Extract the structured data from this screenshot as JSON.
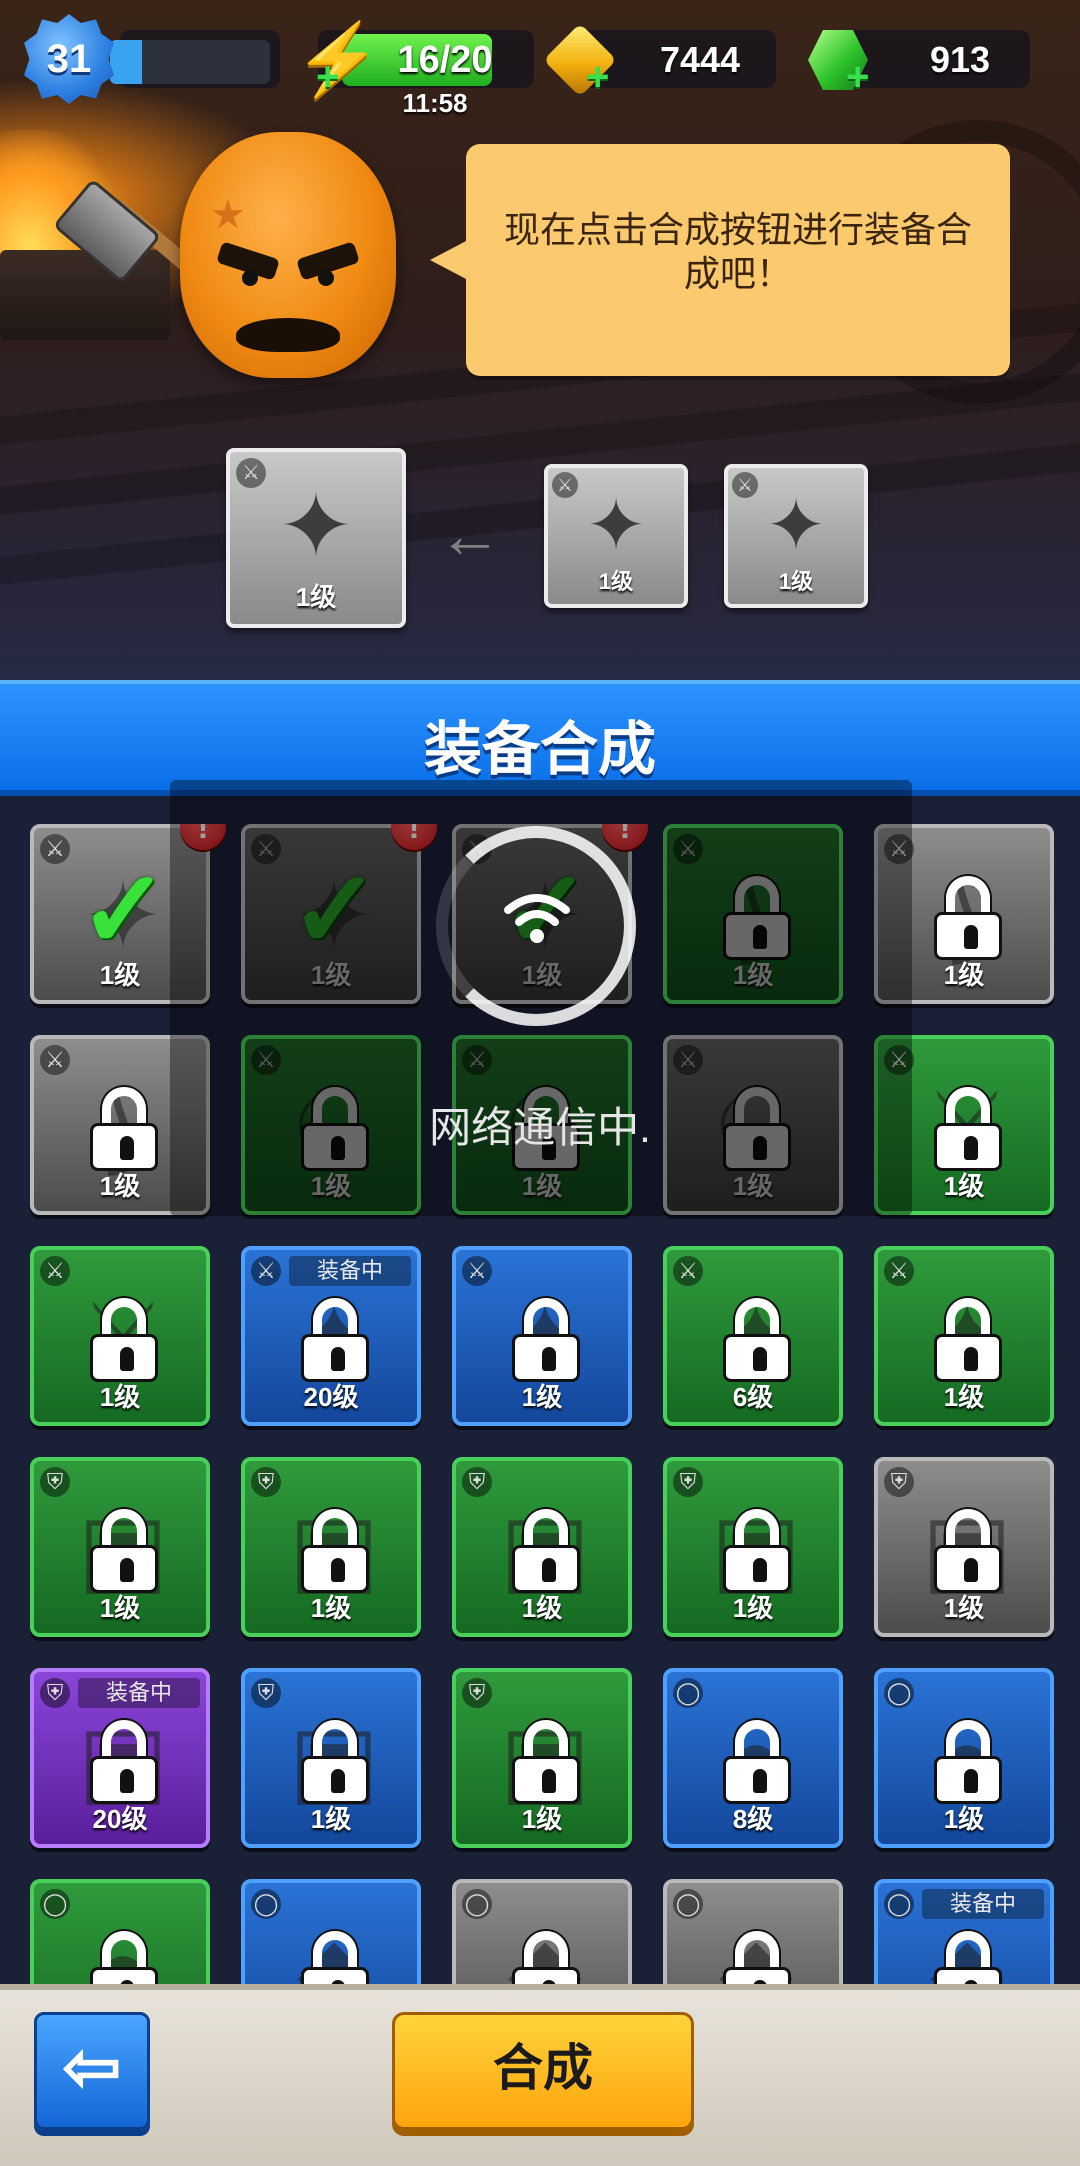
{
  "hud": {
    "player_level": "31",
    "xp_progress": 0.2,
    "energy": "16/20",
    "energy_timer": "11:58",
    "gold": "7444",
    "gems": "913"
  },
  "speech": "现在点击合成按钮进行装备合成吧！",
  "preview": {
    "result_level": "1级",
    "material_1_level": "1级",
    "material_2_level": "1级"
  },
  "header_title": "装备合成",
  "network_status": "网络通信中.",
  "equipped_label": "装备中",
  "grid_rows": [
    [
      {
        "color": "grey",
        "type": "weapon",
        "item": "shuriken",
        "level": "1级",
        "selected": true,
        "alert": true
      },
      {
        "color": "grey",
        "type": "weapon",
        "item": "shuriken",
        "level": "1级",
        "selected": true,
        "alert": true,
        "dim": true
      },
      {
        "color": "grey",
        "type": "weapon",
        "item": "shuriken",
        "level": "1级",
        "selected": true,
        "alert": true,
        "dim": true
      },
      {
        "color": "green",
        "type": "weapon",
        "item": "bow",
        "level": "1级",
        "locked": true,
        "dim": true
      },
      {
        "color": "grey",
        "type": "weapon",
        "item": "bow",
        "level": "1级",
        "locked": true
      }
    ],
    [
      {
        "color": "grey",
        "type": "weapon",
        "item": "bow",
        "level": "1级",
        "locked": true
      },
      {
        "color": "green",
        "type": "weapon",
        "item": "scythe",
        "level": "1级",
        "locked": true,
        "dim": true
      },
      {
        "color": "green",
        "type": "weapon",
        "item": "scythe",
        "level": "1级",
        "locked": true,
        "dim": true
      },
      {
        "color": "grey",
        "type": "weapon",
        "item": "scythe",
        "level": "1级",
        "locked": true,
        "dim": true
      },
      {
        "color": "green",
        "type": "weapon",
        "item": "sword",
        "level": "1级",
        "locked": true
      }
    ],
    [
      {
        "color": "green",
        "type": "weapon",
        "item": "sword",
        "level": "1级",
        "locked": true
      },
      {
        "color": "blue",
        "type": "weapon",
        "item": "shuriken",
        "level": "20级",
        "locked": true,
        "equipped": true
      },
      {
        "color": "blue",
        "type": "weapon",
        "item": "shuriken",
        "level": "1级",
        "locked": true
      },
      {
        "color": "green",
        "type": "weapon",
        "item": "shuriken",
        "level": "6级",
        "locked": true
      },
      {
        "color": "green",
        "type": "weapon",
        "item": "shuriken",
        "level": "1级",
        "locked": true
      }
    ],
    [
      {
        "color": "green",
        "type": "armor",
        "item": "armor-gold",
        "level": "1级",
        "locked": true
      },
      {
        "color": "green",
        "type": "armor",
        "item": "armor-black",
        "level": "1级",
        "locked": true
      },
      {
        "color": "green",
        "type": "armor",
        "item": "armor-black",
        "level": "1级",
        "locked": true
      },
      {
        "color": "green",
        "type": "armor",
        "item": "robe-red",
        "level": "1级",
        "locked": true
      },
      {
        "color": "grey",
        "type": "armor",
        "item": "robe-red",
        "level": "1级",
        "locked": true
      }
    ],
    [
      {
        "color": "purple",
        "type": "armor",
        "item": "vest-purple",
        "level": "20级",
        "locked": true,
        "equipped": true
      },
      {
        "color": "blue",
        "type": "armor",
        "item": "vest-purple",
        "level": "1级",
        "locked": true
      },
      {
        "color": "green",
        "type": "armor",
        "item": "vest-purple",
        "level": "1级",
        "locked": true
      },
      {
        "color": "blue",
        "type": "ring",
        "item": "panda-ring",
        "level": "8级",
        "locked": true
      },
      {
        "color": "blue",
        "type": "ring",
        "item": "panda-ring",
        "level": "1级",
        "locked": true
      }
    ],
    [
      {
        "color": "green",
        "type": "ring",
        "item": "panda-ring",
        "level": "",
        "locked": true
      },
      {
        "color": "blue",
        "type": "ring",
        "item": "wolf-ring",
        "level": "",
        "locked": true
      },
      {
        "color": "grey",
        "type": "ring",
        "item": "wolf-ring",
        "level": "",
        "locked": true
      },
      {
        "color": "grey",
        "type": "ring",
        "item": "wolf-ring",
        "level": "",
        "locked": true
      },
      {
        "color": "blue",
        "type": "ring",
        "item": "dragon-ring",
        "level": "",
        "locked": true,
        "equipped": true
      }
    ]
  ],
  "buttons": {
    "back_icon": "arrow-left-icon",
    "fuse_label": "合成"
  },
  "colors": {
    "header_blue": "#1a84f5",
    "fuse_yellow": "#ffbf1a",
    "lock_white": "#ffffff",
    "check_green": "#39e23a",
    "alert_red": "#e0242a"
  }
}
